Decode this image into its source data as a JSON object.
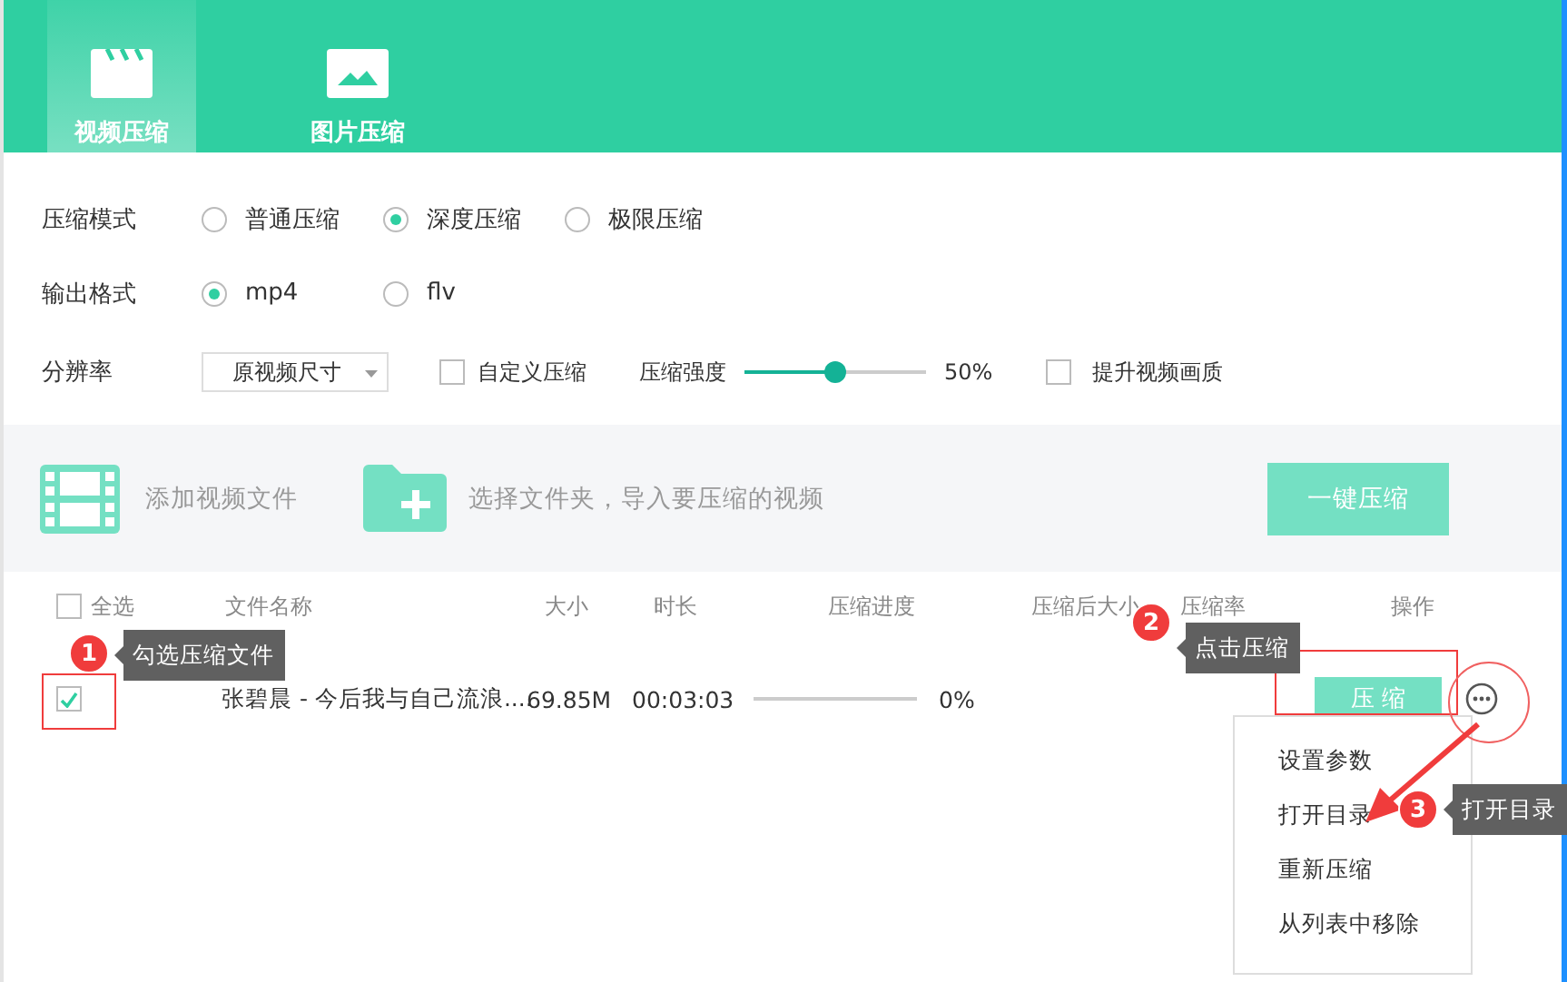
{
  "tabs": [
    {
      "label": "视频压缩",
      "selected": true
    },
    {
      "label": "图片压缩",
      "selected": false
    }
  ],
  "settings": {
    "mode": {
      "label": "压缩模式",
      "options": [
        {
          "label": "普通压缩",
          "selected": false
        },
        {
          "label": "深度压缩",
          "selected": true
        },
        {
          "label": "极限压缩",
          "selected": false
        }
      ]
    },
    "format": {
      "label": "输出格式",
      "options": [
        {
          "label": "mp4",
          "selected": true
        },
        {
          "label": "flv",
          "selected": false
        }
      ]
    },
    "resolution": {
      "label": "分辨率",
      "value": "原视频尺寸"
    },
    "custom_compression": {
      "label": "自定义压缩",
      "checked": false
    },
    "strength": {
      "label": "压缩强度",
      "level": 0.5,
      "reading": "50%"
    },
    "enhance_quality": {
      "label": "提升视频画质",
      "checked": false
    }
  },
  "import_bar": {
    "add_video": "添加视频文件",
    "add_folder": "选择文件夹，导入要压缩的视频",
    "compress_all": "一键压缩"
  },
  "table": {
    "select_all": {
      "label": "全选",
      "checked": false
    },
    "columns": [
      "文件名称",
      "大小",
      "时长",
      "压缩进度",
      "压缩后大小",
      "压缩率",
      "操作"
    ],
    "rows": [
      {
        "checked": true,
        "name": "张碧晨 - 今后我与自己流浪....",
        "size": "69.85M",
        "duration": "00:03:03",
        "level": 0,
        "progress": "0%",
        "action": "压 缩"
      }
    ]
  },
  "context_menu": [
    "设置参数",
    "打开目录",
    "重新压缩",
    "从列表中移除"
  ],
  "annotations": [
    {
      "number": "1",
      "text": "勾选压缩文件"
    },
    {
      "number": "2",
      "text": "点击压缩"
    },
    {
      "number": "3",
      "text": "打开目录"
    }
  ]
}
